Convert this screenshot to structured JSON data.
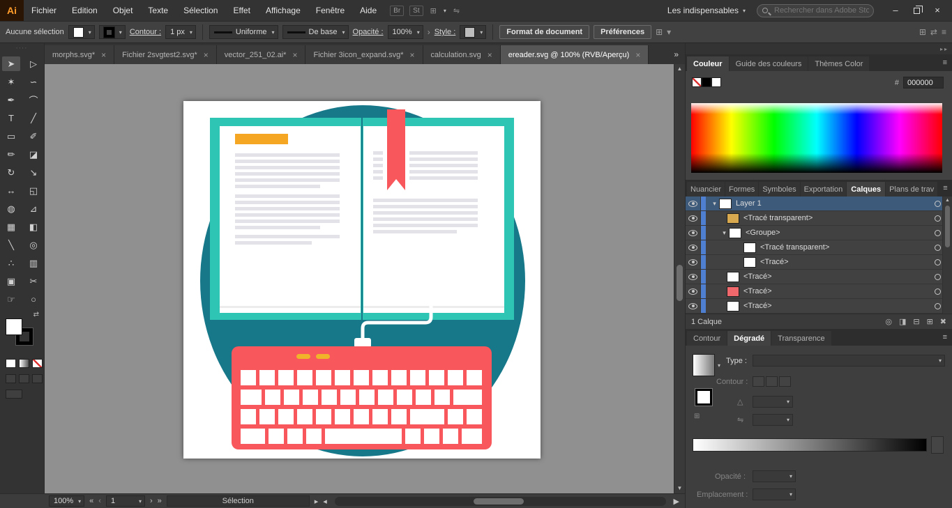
{
  "icons": {
    "chevron": "▾",
    "overflow": "»",
    "close_tab": "×",
    "minimize": "–",
    "close": "×",
    "disclosure": "▾",
    "menu": "≡",
    "grid": "⊞",
    "swap": "⇄",
    "nav_first": "«",
    "nav_prev": "‹",
    "nav_next": "›",
    "nav_last": "»",
    "arrow_up": "▲",
    "arrow_down": "▼",
    "arrow_left": "◀",
    "arrow_right": "▶",
    "tri_right": "▸",
    "tri_left": "◂",
    "angle": "△",
    "reverse": "⇋",
    "hash": "#",
    "grip": "∙∙∙∙"
  },
  "menubar": {
    "logo": "Ai",
    "items": [
      "Fichier",
      "Edition",
      "Objet",
      "Texte",
      "Sélection",
      "Effet",
      "Affichage",
      "Fenêtre",
      "Aide"
    ],
    "badge_br": "Br",
    "badge_st": "St",
    "workspace": "Les indispensables",
    "search_placeholder": "Rechercher dans Adobe Stock"
  },
  "controlbar": {
    "selection_label": "Aucune sélection",
    "stroke_label": "Contour :",
    "stroke_width": "1 px",
    "width_profile": "Uniforme",
    "brush": "De base",
    "opacity_label": "Opacité :",
    "opacity_value": "100%",
    "style_label": "Style :",
    "doc_setup": "Format de document",
    "preferences": "Préférences"
  },
  "tabs": [
    {
      "label": "morphs.svg*"
    },
    {
      "label": "Fichier 2svgtest2.svg*"
    },
    {
      "label": "vector_251_02.ai*"
    },
    {
      "label": "Fichier 3icon_expand.svg*"
    },
    {
      "label": "calculation.svg"
    },
    {
      "label": "ereader.svg @ 100% (RVB/Aperçu)"
    }
  ],
  "tools": [
    {
      "name": "selection-tool",
      "glyph": "➤"
    },
    {
      "name": "direct-selection-tool",
      "glyph": "▷"
    },
    {
      "name": "magic-wand-tool",
      "glyph": "✶"
    },
    {
      "name": "lasso-tool",
      "glyph": "∽"
    },
    {
      "name": "pen-tool",
      "glyph": "✒"
    },
    {
      "name": "curvature-tool",
      "glyph": "⌒"
    },
    {
      "name": "type-tool",
      "glyph": "T"
    },
    {
      "name": "line-segment-tool",
      "glyph": "╱"
    },
    {
      "name": "rectangle-tool",
      "glyph": "▭"
    },
    {
      "name": "paintbrush-tool",
      "glyph": "✐"
    },
    {
      "name": "pencil-tool",
      "glyph": "✏"
    },
    {
      "name": "eraser-tool",
      "glyph": "◪"
    },
    {
      "name": "rotate-tool",
      "glyph": "↻"
    },
    {
      "name": "scale-tool",
      "glyph": "↘"
    },
    {
      "name": "width-tool",
      "glyph": "↔"
    },
    {
      "name": "free-transform-tool",
      "glyph": "◱"
    },
    {
      "name": "shape-builder-tool",
      "glyph": "◍"
    },
    {
      "name": "perspective-grid-tool",
      "glyph": "⊿"
    },
    {
      "name": "mesh-tool",
      "glyph": "▦"
    },
    {
      "name": "gradient-tool",
      "glyph": "◧"
    },
    {
      "name": "eyedropper-tool",
      "glyph": "╲"
    },
    {
      "name": "blend-tool",
      "glyph": "◎"
    },
    {
      "name": "symbol-sprayer-tool",
      "glyph": "∴"
    },
    {
      "name": "column-graph-tool",
      "glyph": "▥"
    },
    {
      "name": "artboard-tool",
      "glyph": "▣"
    },
    {
      "name": "slice-tool",
      "glyph": "✂"
    },
    {
      "name": "hand-tool",
      "glyph": "☞"
    },
    {
      "name": "zoom-tool",
      "glyph": "○"
    }
  ],
  "dock": {
    "color_tabs": [
      "Couleur",
      "Guide des couleurs",
      "Thèmes Color"
    ],
    "hex_label": "#",
    "hex_value": "000000",
    "panel_tabs": [
      "Nuancier",
      "Formes",
      "Symboles",
      "Exportation",
      "Calques",
      "Plans de trav"
    ],
    "layers": {
      "rows": [
        {
          "name": "Layer 1"
        },
        {
          "name": "<Tracé transparent>"
        },
        {
          "name": "<Groupe>"
        },
        {
          "name": "<Tracé transparent>"
        },
        {
          "name": "<Tracé>"
        },
        {
          "name": "<Tracé>"
        },
        {
          "name": "<Tracé>"
        },
        {
          "name": "<Tracé>"
        }
      ],
      "footer": "1 Calque"
    },
    "bottom_tabs": [
      "Contour",
      "Dégradé",
      "Transparence"
    ],
    "gradient": {
      "type_label": "Type :",
      "stroke_label": "Contour :",
      "opacity_label": "Opacité :",
      "location_label": "Emplacement :"
    }
  },
  "statusbar": {
    "zoom": "100%",
    "artboard": "1",
    "status": "Sélection"
  },
  "artwork_colors": {
    "background_circle": "#17788a",
    "book_cover": "#2fc5b5",
    "keyboard": "#f8575c",
    "bookmark": "#f8575c",
    "highlight": "#f5a623",
    "indicator_keys": "#f0b32a",
    "text_lines": "#e2e2e8"
  }
}
